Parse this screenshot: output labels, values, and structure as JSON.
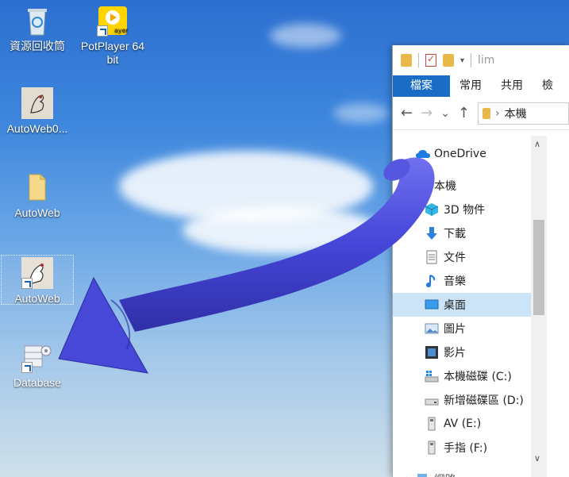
{
  "desktop": {
    "icons": [
      {
        "label": "資源回收筒",
        "icon": "recycle-bin-icon"
      },
      {
        "label": "PotPlayer 64 bit",
        "icon": "potplayer-icon"
      },
      {
        "label": "AutoWeb0...",
        "icon": "autoweb-sketch-icon"
      },
      {
        "label": "AutoWeb",
        "icon": "folder-icon"
      },
      {
        "label": "AutoWeb",
        "icon": "autoweb-shortcut-icon"
      },
      {
        "label": "Database",
        "icon": "database-shortcut-icon"
      }
    ]
  },
  "explorer": {
    "title": "lim",
    "ribbon_tabs": [
      "檔案",
      "常用",
      "共用",
      "檢"
    ],
    "address": "本機",
    "nav": {
      "back": "←",
      "forward": "→",
      "dropdown": "⌄",
      "up": "↑"
    },
    "tree": [
      {
        "label": "OneDrive",
        "icon": "onedrive-icon"
      },
      {
        "label": "本機",
        "icon": "this-pc-icon"
      },
      {
        "label": "3D 物件",
        "icon": "3d-objects-icon"
      },
      {
        "label": "下載",
        "icon": "downloads-icon"
      },
      {
        "label": "文件",
        "icon": "documents-icon"
      },
      {
        "label": "音樂",
        "icon": "music-icon"
      },
      {
        "label": "桌面",
        "icon": "desktop-icon"
      },
      {
        "label": "圖片",
        "icon": "pictures-icon"
      },
      {
        "label": "影片",
        "icon": "videos-icon"
      },
      {
        "label": "本機磁碟 (C:)",
        "icon": "windows-drive-icon"
      },
      {
        "label": "新增磁碟區 (D:)",
        "icon": "drive-icon"
      },
      {
        "label": "AV (E:)",
        "icon": "removable-drive-icon"
      },
      {
        "label": "手指 (F:)",
        "icon": "removable-drive-icon"
      },
      {
        "label": "網路",
        "icon": "network-icon"
      }
    ],
    "selected_tree_item": "桌面"
  },
  "annotation": {
    "icon": "arrow-annotation-icon",
    "color": "#4e4edc"
  }
}
